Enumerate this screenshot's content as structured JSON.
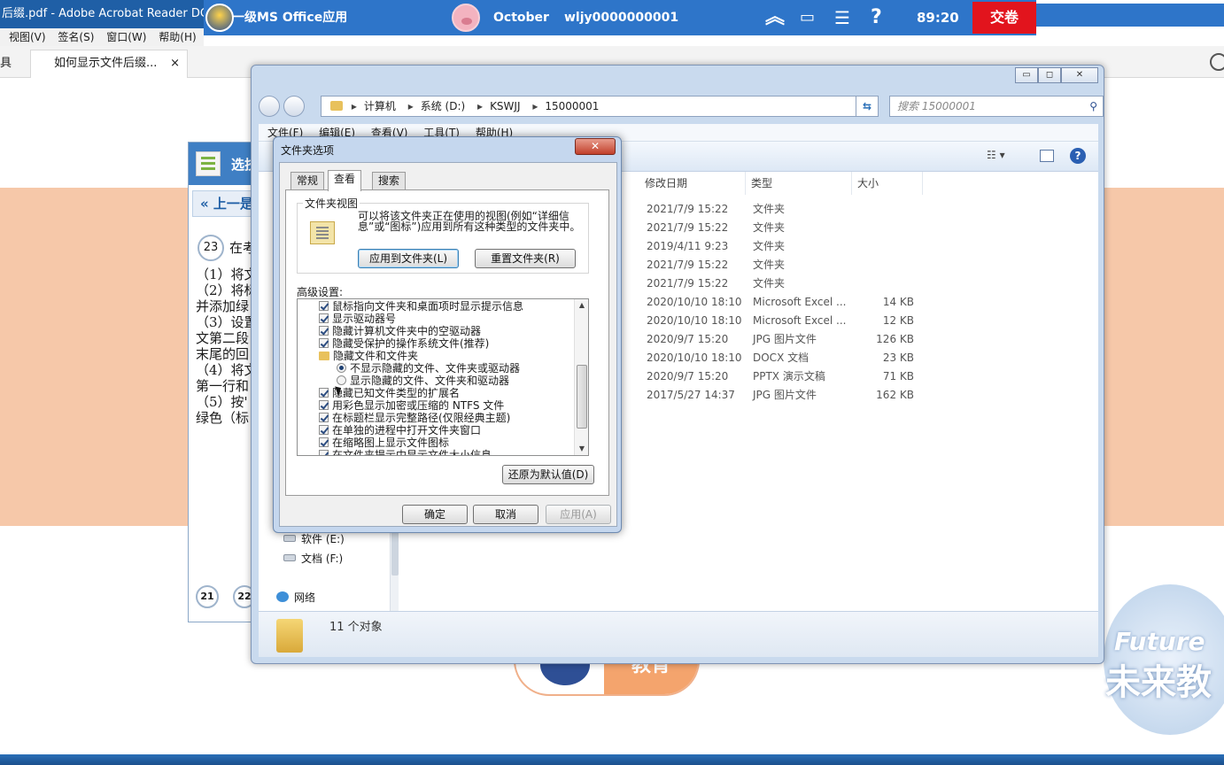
{
  "acrobat": {
    "title": "后缀.pdf - Adobe Acrobat Reader DC (",
    "menu": [
      "视图(V)",
      "签名(S)",
      "窗口(W)",
      "帮助(H)"
    ],
    "tab_left": "具",
    "tab_label": "如何显示文件后缀...",
    "tab_close": "×"
  },
  "exam_bar": {
    "subject": "一级MS Office应用",
    "month": "October",
    "user": "wljy0000000001",
    "icons": [
      "collapse-up-icon",
      "monitor-icon",
      "checklist-icon",
      "help-icon"
    ],
    "icon_glyphs": [
      "︽",
      "▭",
      "☰",
      "?"
    ],
    "timer": "89:20",
    "submit": "交卷",
    "submit_color": "#e2141d",
    "bar_color": "#2e75c9"
  },
  "question_panel": {
    "title": "选技",
    "prev": "« 上一是",
    "number": "23",
    "lines": [
      "在考",
      "（1）将文",
      "（2）将标",
      "并添加绿",
      "（3）设置",
      "文第二段",
      "末尾的回",
      "（4）将文",
      "第一行和",
      "（5）按'",
      "绿色（标"
    ],
    "nav": [
      "21",
      "22"
    ]
  },
  "logo": {
    "text": "教育",
    "watermark_en": "Future",
    "watermark_cn": "未来教"
  },
  "explorer": {
    "controls": [
      "▭",
      "◻",
      "✕"
    ],
    "address": [
      "计算机",
      "系统 (D:)",
      "KSWJJ",
      "15000001"
    ],
    "search_placeholder": "搜索 15000001",
    "menu": [
      "文件(F)",
      "编辑(E)",
      "查看(V)",
      "工具(T)",
      "帮助(H)"
    ],
    "columns": [
      "修改日期",
      "类型",
      "大小"
    ],
    "rows": [
      {
        "date": "2021/7/9 15:22",
        "type": "文件夹",
        "size": ""
      },
      {
        "date": "2021/7/9 15:22",
        "type": "文件夹",
        "size": ""
      },
      {
        "date": "2019/4/11 9:23",
        "type": "文件夹",
        "size": ""
      },
      {
        "date": "2021/7/9 15:22",
        "type": "文件夹",
        "size": ""
      },
      {
        "date": "2021/7/9 15:22",
        "type": "文件夹",
        "size": ""
      },
      {
        "date": "2020/10/10 18:10",
        "type": "Microsoft Excel ...",
        "size": "14 KB"
      },
      {
        "date": "2020/10/10 18:10",
        "type": "Microsoft Excel ...",
        "size": "12 KB"
      },
      {
        "date": "2020/9/7 15:20",
        "type": "JPG 图片文件",
        "size": "126 KB"
      },
      {
        "date": "2020/10/10 18:10",
        "type": "DOCX 文档",
        "size": "23 KB"
      },
      {
        "date": "2020/9/7 15:20",
        "type": "PPTX 演示文稿",
        "size": "71 KB"
      },
      {
        "date": "2017/5/27 14:37",
        "type": "JPG 图片文件",
        "size": "162 KB"
      }
    ],
    "nav_items": [
      "软件 (E:)",
      "文档 (F:)"
    ],
    "network": "网络",
    "status": "11 个对象"
  },
  "dialog": {
    "title": "文件夹选项",
    "close": "✕",
    "tabs": [
      "常规",
      "查看",
      "搜索"
    ],
    "active_tab": "查看",
    "group_title": "文件夹视图",
    "group_desc": "可以将该文件夹正在使用的视图(例如“详细信息”或“图标”)应用到所有这种类型的文件夹中。",
    "apply_folders": "应用到文件夹(L)",
    "reset_folders": "重置文件夹(R)",
    "advanced_label": "高级设置:",
    "advanced_items": [
      {
        "kind": "check",
        "label": "鼠标指向文件夹和桌面项时显示提示信息",
        "checked": true
      },
      {
        "kind": "check",
        "label": "显示驱动器号",
        "checked": true
      },
      {
        "kind": "check",
        "label": "隐藏计算机文件夹中的空驱动器",
        "checked": true
      },
      {
        "kind": "check",
        "label": "隐藏受保护的操作系统文件(推荐)",
        "checked": true
      },
      {
        "kind": "folder",
        "label": "隐藏文件和文件夹"
      },
      {
        "kind": "radio",
        "label": "不显示隐藏的文件、文件夹或驱动器",
        "selected": true
      },
      {
        "kind": "radio",
        "label": "显示隐藏的文件、文件夹和驱动器",
        "selected": false
      },
      {
        "kind": "check",
        "label": "隐藏已知文件类型的扩展名",
        "checked": true
      },
      {
        "kind": "check",
        "label": "用彩色显示加密或压缩的 NTFS 文件",
        "checked": true
      },
      {
        "kind": "check",
        "label": "在标题栏显示完整路径(仅限经典主题)",
        "checked": true
      },
      {
        "kind": "check",
        "label": "在单独的进程中打开文件夹窗口",
        "checked": true
      },
      {
        "kind": "check",
        "label": "在缩略图上显示文件图标",
        "checked": true
      },
      {
        "kind": "check",
        "label": "在文件夹提示中显示文件大小信息",
        "checked": true
      }
    ],
    "restore_defaults": "还原为默认值(D)",
    "ok": "确定",
    "cancel": "取消",
    "apply": "应用(A)"
  }
}
